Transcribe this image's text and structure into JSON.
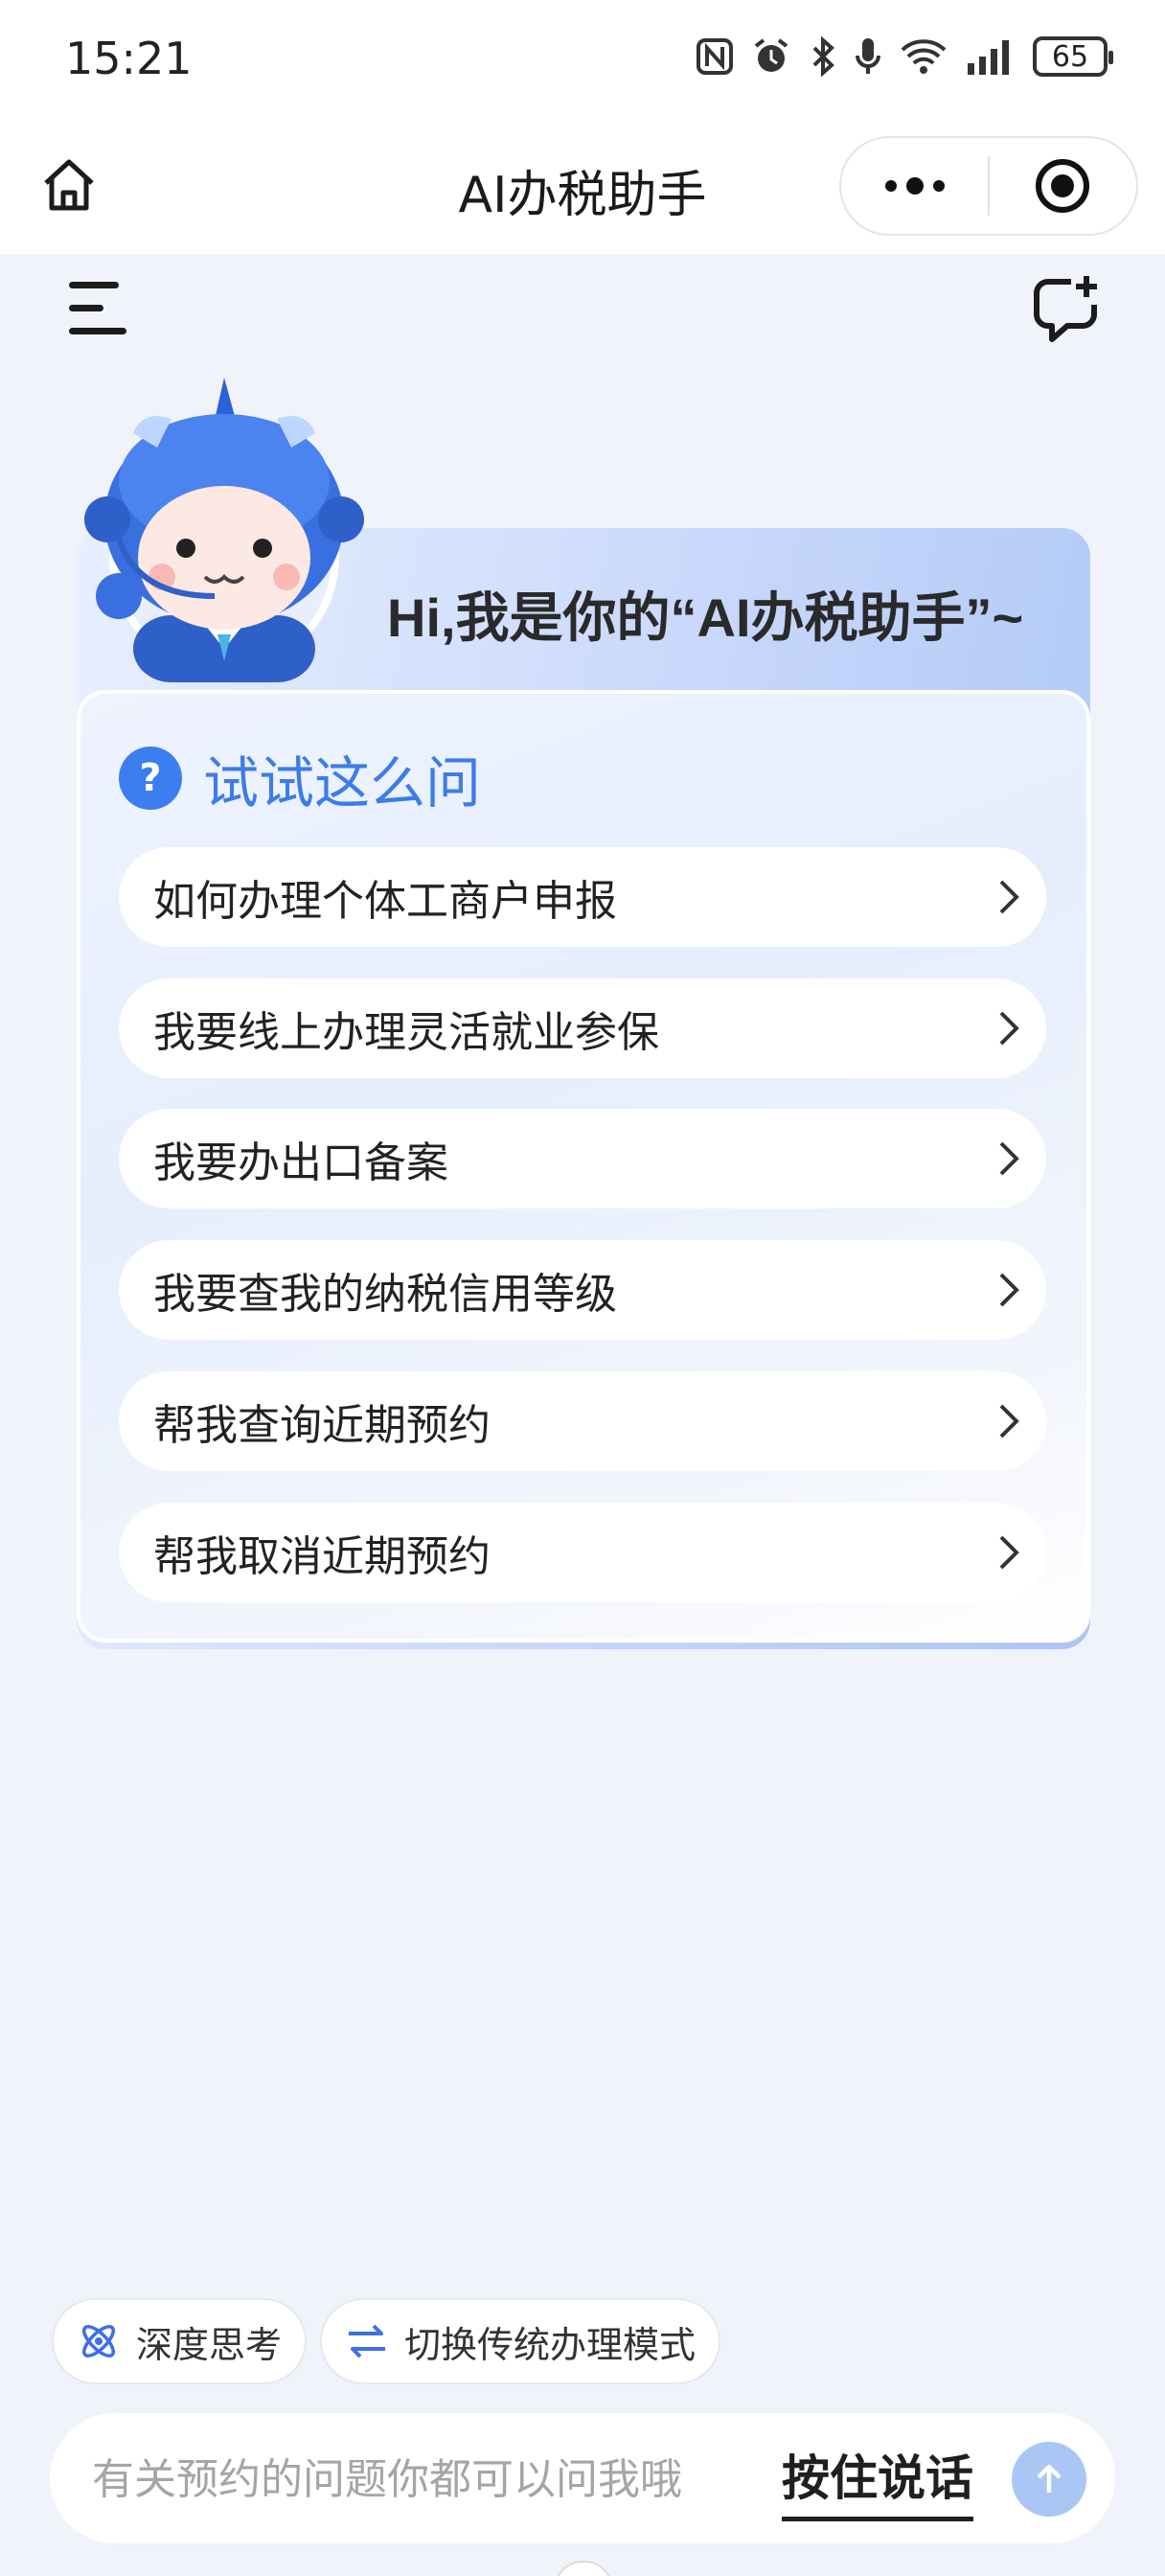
{
  "status_bar": {
    "time": "15:21",
    "battery": "65",
    "icons": [
      "nfc-icon",
      "alarm-icon",
      "bluetooth-icon",
      "mic-icon",
      "wifi-icon",
      "signal-icon",
      "battery-icon"
    ]
  },
  "nav": {
    "title": "AI办税助手",
    "home_icon": "home-icon",
    "more_icon": "more-dots-icon",
    "close_icon": "target-circle-icon"
  },
  "toolbar": {
    "menu_icon": "menu-icon",
    "new_chat_icon": "new-chat-icon"
  },
  "welcome": {
    "greeting": "Hi,我是你的“AI办税助手”~",
    "suggest_title": "试试这么问",
    "suggestions": [
      {
        "label": "如何办理个体工商户申报"
      },
      {
        "label": "我要线上办理灵活就业参保"
      },
      {
        "label": "我要办出口备案"
      },
      {
        "label": "我要查我的纳税信用等级"
      },
      {
        "label": "帮我查询近期预约"
      },
      {
        "label": "帮我取消近期预约"
      }
    ]
  },
  "chips": {
    "deep_think": "深度思考",
    "switch_mode": "切换传统办理模式"
  },
  "input": {
    "placeholder": "有关预约的问题你都可以问我哦",
    "value": "",
    "hold_to_talk": "按住说话"
  },
  "colors": {
    "accent": "#3d7ce8",
    "background": "#f1f3fa",
    "send_button": "#a9c6f5"
  }
}
